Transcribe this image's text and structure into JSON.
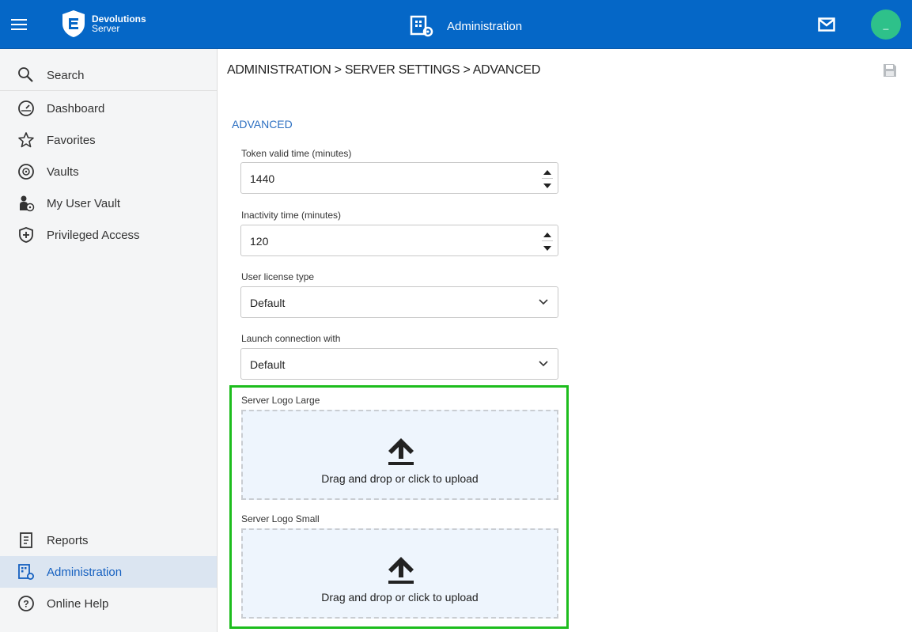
{
  "app": {
    "brand_line1": "Devolutions",
    "brand_line2": "Server",
    "header_title": "Administration",
    "colors": {
      "topbar": "#0567c7",
      "accent": "#2c6fc1",
      "avatar": "#2ec18a",
      "highlight_frame": "#1dbd1d"
    }
  },
  "sidebar": {
    "items": [
      {
        "label": "Search",
        "icon": "search-icon"
      },
      {
        "label": "Dashboard",
        "icon": "dashboard-icon"
      },
      {
        "label": "Favorites",
        "icon": "star-icon"
      },
      {
        "label": "Vaults",
        "icon": "vault-icon"
      },
      {
        "label": "My User Vault",
        "icon": "user-vault-icon"
      },
      {
        "label": "Privileged Access",
        "icon": "shield-icon"
      }
    ],
    "bottom_items": [
      {
        "label": "Reports",
        "icon": "reports-icon"
      },
      {
        "label": "Administration",
        "icon": "administration-icon",
        "active": true
      },
      {
        "label": "Online Help",
        "icon": "help-icon"
      }
    ]
  },
  "main": {
    "breadcrumb": "ADMINISTRATION  > SERVER SETTINGS  > ADVANCED",
    "section_title": "ADVANCED",
    "fields": {
      "token": {
        "label": "Token valid time (minutes)",
        "value": "1440"
      },
      "inactivity": {
        "label": "Inactivity time (minutes)",
        "value": "120"
      },
      "license": {
        "label": "User license type",
        "value": "Default"
      },
      "launch": {
        "label": "Launch connection with",
        "value": "Default"
      }
    },
    "logo_large": {
      "label": "Server Logo Large",
      "text": "Drag and drop or click to upload"
    },
    "logo_small": {
      "label": "Server Logo Small",
      "text": "Drag and drop or click to upload"
    }
  }
}
